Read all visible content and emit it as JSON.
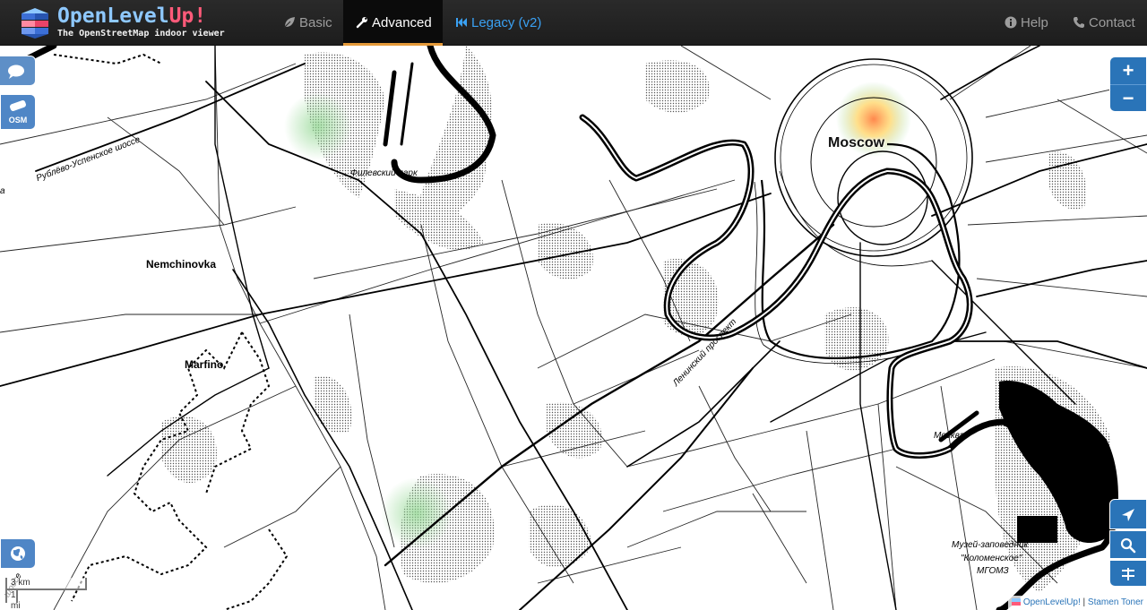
{
  "brand": {
    "name_part1": "OpenLevel",
    "name_part2": "Up!",
    "subtitle": "The OpenStreetMap indoor viewer"
  },
  "nav": {
    "basic": "Basic",
    "advanced": "Advanced",
    "legacy": "Legacy (v2)",
    "help": "Help",
    "contact": "Contact"
  },
  "map": {
    "labels": {
      "moscow": "Moscow",
      "nemchinovka": "Nemchinovka",
      "marfino": "Marfino",
      "filevsky_park": "Филевский парк",
      "moskva_river": "Москва",
      "leninsky": "Ленинский проспект",
      "rublevo": "Рублёво-Успенское шоссе",
      "shosse_fragment": "шоссе",
      "museum_line1": "Музей-заповедник",
      "museum_line2": "\"Коломенское\"",
      "museum_line3": "МГОМЗ",
      "edge_a": "a"
    },
    "controls": {
      "zoom_in": "+",
      "zoom_out": "−",
      "osm_label": "OSM"
    },
    "scale": {
      "km": "3 km",
      "mi": "1 mi"
    },
    "attribution": {
      "openlevelup": "OpenLevelUp!",
      "separator": " | ",
      "tiles": "Stamen Toner"
    }
  },
  "colors": {
    "navbar_bg": "#222222",
    "brand_blue": "#8ec8ff",
    "brand_pink": "#ff5a79",
    "active_tab_underline": "#e59a3a",
    "legacy_link": "#3aa1f3",
    "control_blue": "#2a74b8",
    "heatmap_green": "#7ed07e",
    "heatmap_hot": "#ff8a3a"
  }
}
